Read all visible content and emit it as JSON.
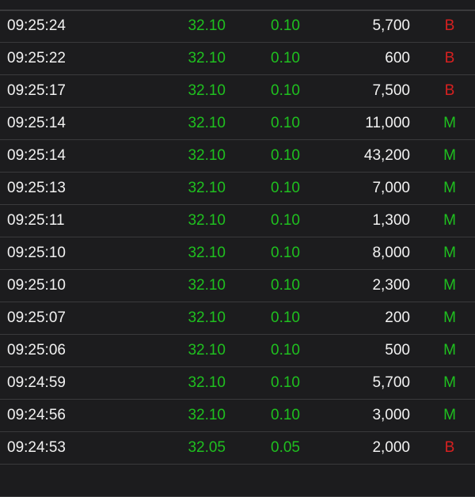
{
  "colors": {
    "background": "#1c1c1e",
    "divider": "#3a3a3c",
    "text": "#f2f2f2",
    "up_green": "#1fc01f",
    "sell_red": "#d62020"
  },
  "trades": [
    {
      "time": "",
      "price": "",
      "change": "",
      "volume": "",
      "side": "",
      "side_color": "#d62020"
    },
    {
      "time": "09:25:24",
      "price": "32.10",
      "change": "0.10",
      "volume": "5,700",
      "side": "B",
      "side_color": "#d62020"
    },
    {
      "time": "09:25:22",
      "price": "32.10",
      "change": "0.10",
      "volume": "600",
      "side": "B",
      "side_color": "#d62020"
    },
    {
      "time": "09:25:17",
      "price": "32.10",
      "change": "0.10",
      "volume": "7,500",
      "side": "B",
      "side_color": "#d62020"
    },
    {
      "time": "09:25:14",
      "price": "32.10",
      "change": "0.10",
      "volume": "11,000",
      "side": "M",
      "side_color": "#1fc01f"
    },
    {
      "time": "09:25:14",
      "price": "32.10",
      "change": "0.10",
      "volume": "43,200",
      "side": "M",
      "side_color": "#1fc01f"
    },
    {
      "time": "09:25:13",
      "price": "32.10",
      "change": "0.10",
      "volume": "7,000",
      "side": "M",
      "side_color": "#1fc01f"
    },
    {
      "time": "09:25:11",
      "price": "32.10",
      "change": "0.10",
      "volume": "1,300",
      "side": "M",
      "side_color": "#1fc01f"
    },
    {
      "time": "09:25:10",
      "price": "32.10",
      "change": "0.10",
      "volume": "8,000",
      "side": "M",
      "side_color": "#1fc01f"
    },
    {
      "time": "09:25:10",
      "price": "32.10",
      "change": "0.10",
      "volume": "2,300",
      "side": "M",
      "side_color": "#1fc01f"
    },
    {
      "time": "09:25:07",
      "price": "32.10",
      "change": "0.10",
      "volume": "200",
      "side": "M",
      "side_color": "#1fc01f"
    },
    {
      "time": "09:25:06",
      "price": "32.10",
      "change": "0.10",
      "volume": "500",
      "side": "M",
      "side_color": "#1fc01f"
    },
    {
      "time": "09:24:59",
      "price": "32.10",
      "change": "0.10",
      "volume": "5,700",
      "side": "M",
      "side_color": "#1fc01f"
    },
    {
      "time": "09:24:56",
      "price": "32.10",
      "change": "0.10",
      "volume": "3,000",
      "side": "M",
      "side_color": "#1fc01f"
    },
    {
      "time": "09:24:53",
      "price": "32.05",
      "change": "0.05",
      "volume": "2,000",
      "side": "B",
      "side_color": "#d62020"
    },
    {
      "time": "",
      "price": "",
      "change": "",
      "volume": "",
      "side": "",
      "side_color": "#d62020"
    }
  ]
}
